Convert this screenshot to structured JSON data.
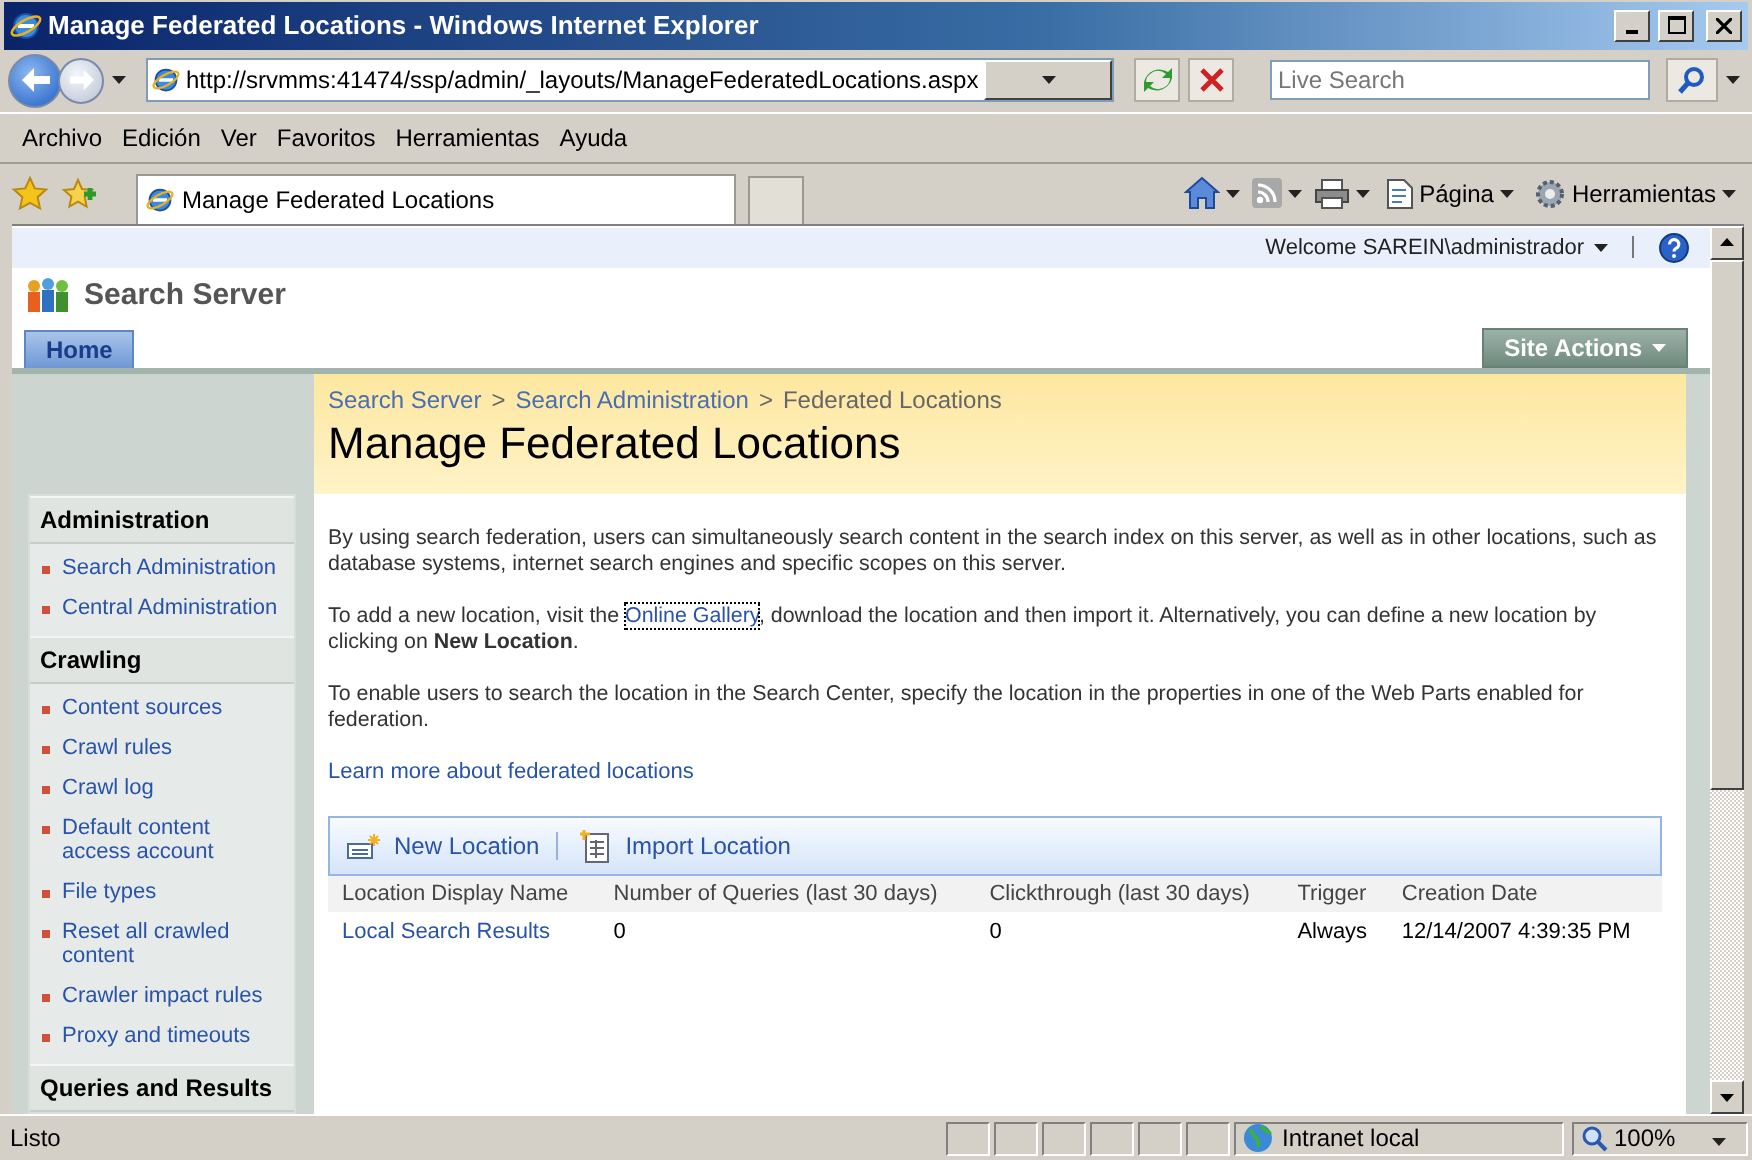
{
  "window": {
    "title": "Manage Federated Locations - Windows Internet Explorer"
  },
  "address_bar": {
    "url": "http://srvmms:41474/ssp/admin/_layouts/ManageFederatedLocations.aspx"
  },
  "search": {
    "placeholder": "Live Search"
  },
  "menu": [
    "Archivo",
    "Edición",
    "Ver",
    "Favoritos",
    "Herramientas",
    "Ayuda"
  ],
  "browser_tabs": [
    {
      "label": "Manage Federated Locations",
      "selected": true
    }
  ],
  "command_bar": [
    {
      "kind": "page",
      "label": "Página"
    },
    {
      "kind": "tools",
      "label": "Herramientas"
    }
  ],
  "page": {
    "welcome": "Welcome SAREIN\\administrador",
    "site_title": "Search Server",
    "tabs": [
      {
        "label": "Home",
        "selected": true
      }
    ],
    "site_actions": "Site Actions",
    "breadcrumb": [
      {
        "kind": "link",
        "text": "Search Server"
      },
      {
        "kind": "separator",
        "text": ">"
      },
      {
        "kind": "link",
        "text": "Search Administration"
      },
      {
        "kind": "separator",
        "text": ">"
      },
      {
        "kind": "current",
        "text": "Federated Locations"
      }
    ],
    "title": "Manage Federated Locations",
    "nav": [
      {
        "title": "Administration",
        "items": [
          "Search Administration",
          "Central Administration"
        ]
      },
      {
        "title": "Crawling",
        "items": [
          "Content sources",
          "Crawl rules",
          "Crawl log",
          "Default content access account",
          "File types",
          "Reset all crawled content",
          "Crawler impact rules",
          "Proxy and timeouts"
        ]
      },
      {
        "title": "Queries and Results"
      }
    ],
    "paragraphs": [
      [
        {
          "kind": "text",
          "text": "By using search federation, users can simultaneously search content in the search index on this server, as well as in other locations, such as database systems, internet search engines and specific scopes on this server."
        }
      ],
      [
        {
          "kind": "text",
          "text": "To add a new location, visit the "
        },
        {
          "kind": "link",
          "text": "Online Gallery"
        },
        {
          "kind": "text",
          "text": ", download the location and then import it. Alternatively, you can define a new location by clicking on **New Location**."
        }
      ],
      [
        {
          "kind": "text",
          "text": "To enable users to search the location in the Search Center, specify the location in the properties in one of the Web Parts enabled for federation."
        }
      ]
    ],
    "learn_more": "Learn more about federated locations",
    "toolbar": [
      {
        "kind": "new",
        "label": "New Location"
      },
      {
        "kind": "import",
        "label": "Import Location"
      }
    ],
    "table": {
      "columns": [
        "Location Display Name",
        "Number of Queries (last 30 days)",
        "Clickthrough (last 30 days)",
        "Trigger",
        "Creation Date"
      ],
      "rows": [
        [
          "Local Search Results",
          "0",
          "0",
          "Always",
          "12/14/2007 4:39:35 PM"
        ]
      ]
    }
  },
  "status_bar": {
    "text": "Listo",
    "zone": "Intranet local",
    "zoom": "100%"
  }
}
